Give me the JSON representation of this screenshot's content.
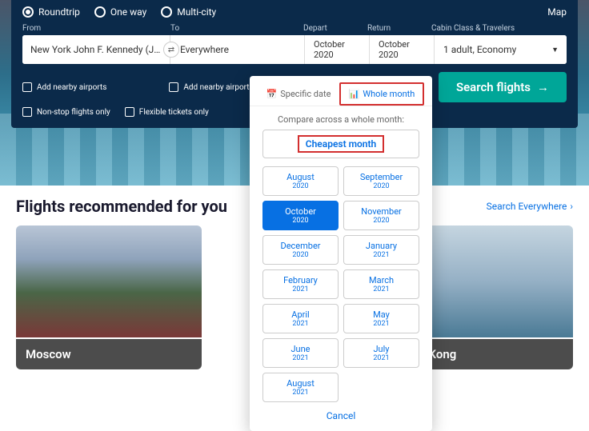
{
  "tripTypes": {
    "roundtrip": "Roundtrip",
    "oneway": "One way",
    "multi": "Multi-city"
  },
  "mapLink": "Map",
  "labels": {
    "from": "From",
    "to": "To",
    "depart": "Depart",
    "return": "Return",
    "cabin": "Cabin Class & Travelers"
  },
  "fields": {
    "from": "New York John F. Kennedy (J…",
    "to": "Everywhere",
    "depart": "October 2020",
    "return": "October 2020",
    "cabin": "1 adult, Economy"
  },
  "options": {
    "nearbyFrom": "Add nearby airports",
    "nearbyTo": "Add nearby airports",
    "nonstop": "Non-stop flights only",
    "flexible": "Flexible tickets only"
  },
  "searchBtn": "Search flights",
  "popover": {
    "tabSpecific": "Specific date",
    "tabWhole": "Whole month",
    "compare": "Compare across a whole month:",
    "cheapest": "Cheapest month",
    "months": [
      {
        "m": "August",
        "y": "2020"
      },
      {
        "m": "September",
        "y": "2020"
      },
      {
        "m": "October",
        "y": "2020",
        "selected": true
      },
      {
        "m": "November",
        "y": "2020"
      },
      {
        "m": "December",
        "y": "2020"
      },
      {
        "m": "January",
        "y": "2021"
      },
      {
        "m": "February",
        "y": "2021"
      },
      {
        "m": "March",
        "y": "2021"
      },
      {
        "m": "April",
        "y": "2021"
      },
      {
        "m": "May",
        "y": "2021"
      },
      {
        "m": "June",
        "y": "2021"
      },
      {
        "m": "July",
        "y": "2021"
      },
      {
        "m": "August",
        "y": "2021"
      }
    ],
    "cancel": "Cancel"
  },
  "rec": {
    "title": "Flights recommended for you",
    "link": "Search Everywhere",
    "cards": [
      {
        "name": "Moscow"
      },
      {
        "name": "Hong Kong"
      }
    ]
  }
}
